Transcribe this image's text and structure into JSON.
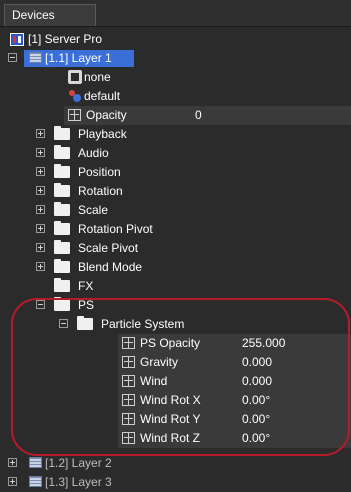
{
  "panel": {
    "title": "Devices"
  },
  "tree": {
    "server": {
      "label": "[1] Server Pro"
    },
    "layer1": {
      "label": "[1.1] Layer 1",
      "media": "none",
      "preset": "default",
      "opacity": {
        "label": "Opacity",
        "value": "0"
      },
      "groups": [
        "Playback",
        "Audio",
        "Position",
        "Rotation",
        "Scale",
        "Rotation Pivot",
        "Scale Pivot",
        "Blend Mode",
        "FX",
        "PS"
      ],
      "particle_system": {
        "label": "Particle System",
        "params": [
          {
            "label": "PS Opacity",
            "value": "255.000"
          },
          {
            "label": "Gravity",
            "value": "0.000"
          },
          {
            "label": "Wind",
            "value": "0.000"
          },
          {
            "label": "Wind Rot X",
            "value": "0.00°"
          },
          {
            "label": "Wind Rot Y",
            "value": "0.00°"
          },
          {
            "label": "Wind Rot Z",
            "value": "0.00°"
          }
        ]
      }
    },
    "layer2": {
      "label": "[1.2] Layer 2"
    },
    "layer3": {
      "label": "[1.3] Layer 3"
    }
  },
  "highlight_color": "#b51c2a",
  "selection_color": "#3a6fd8"
}
